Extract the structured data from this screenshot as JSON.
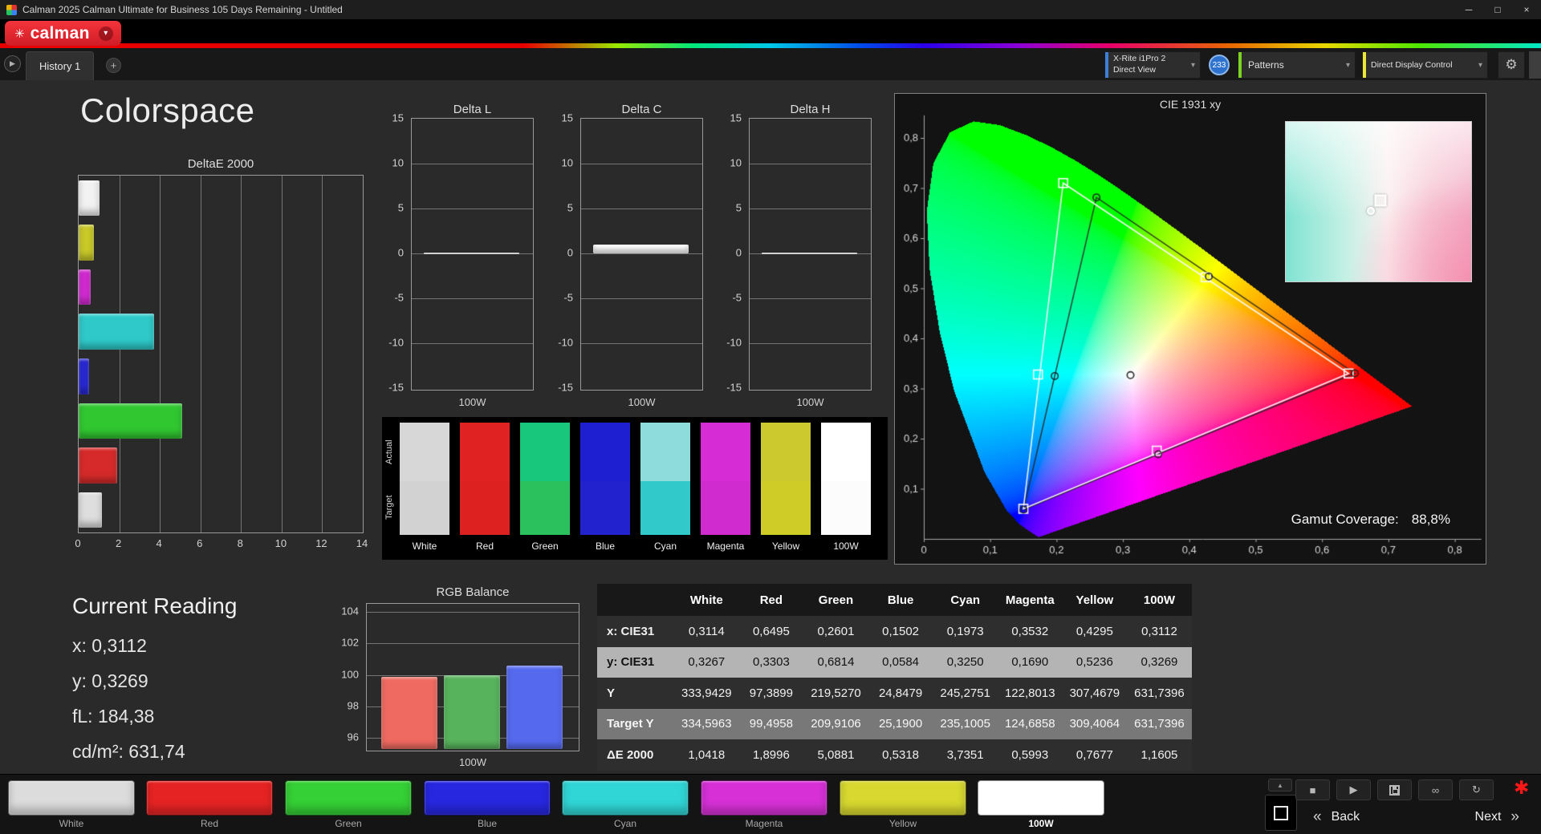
{
  "window": {
    "title": "Calman 2025 Calman Ultimate for Business 105 Days Remaining  - Untitled"
  },
  "logo": {
    "brand": "calman"
  },
  "tabs": {
    "history_tab": "History 1"
  },
  "toolbar": {
    "meter_line1": "X-Rite i1Pro 2",
    "meter_line2": "Direct View",
    "meter_badge": "233",
    "patterns_label": "Patterns",
    "display_label": "Direct Display Control"
  },
  "page": {
    "title": "Colorspace"
  },
  "current_reading": {
    "title": "Current Reading",
    "lines": [
      "x: 0,3112",
      "y: 0,3269",
      "fL: 184,38",
      "cd/m²: 631,74"
    ]
  },
  "gamut": {
    "label": "Gamut Coverage:",
    "value": "88,8%"
  },
  "chart_data": [
    {
      "id": "deltae2000",
      "type": "bar",
      "orientation": "horizontal",
      "title": "DeltaE 2000",
      "categories": [
        "White",
        "Yellow",
        "Magenta",
        "Cyan",
        "Blue",
        "Green",
        "Red",
        "100W"
      ],
      "values": [
        1.0418,
        0.7677,
        0.5993,
        3.7351,
        0.5318,
        5.0881,
        1.8996,
        1.1605
      ],
      "colors": [
        "#f2f2f2",
        "#c9c929",
        "#d32ad3",
        "#2fc9c9",
        "#2828d6",
        "#31c731",
        "#d62a2a",
        "#dedede"
      ],
      "xlim": [
        0,
        14
      ],
      "xticks": [
        0,
        2,
        4,
        6,
        8,
        10,
        12,
        14
      ],
      "xtick_labels": [
        "0",
        "2",
        "4",
        "6",
        "8",
        "10",
        "12",
        "14"
      ]
    },
    {
      "id": "delta_l",
      "type": "bar",
      "title": "Delta L",
      "categories": [
        "100W"
      ],
      "values": [
        0.05
      ],
      "bar_color": "#ffffff",
      "ylim": [
        -15,
        15
      ],
      "yticks": [
        15,
        10,
        5,
        0,
        -5,
        -10,
        -15
      ],
      "ytick_labels": [
        "15",
        "10",
        "5",
        "0",
        "-5",
        "-10",
        "-15"
      ],
      "xlabel": "100W"
    },
    {
      "id": "delta_c",
      "type": "bar",
      "title": "Delta C",
      "categories": [
        "100W"
      ],
      "values": [
        0.95
      ],
      "bar_color": "#ffffff",
      "ylim": [
        -15,
        15
      ],
      "yticks": [
        15,
        10,
        5,
        0,
        -5,
        -10,
        -15
      ],
      "ytick_labels": [
        "15",
        "10",
        "5",
        "0",
        "-5",
        "-10",
        "-15"
      ],
      "xlabel": "100W"
    },
    {
      "id": "delta_h",
      "type": "bar",
      "title": "Delta H",
      "categories": [
        "100W"
      ],
      "values": [
        0.05
      ],
      "bar_color": "#ffffff",
      "ylim": [
        -15,
        15
      ],
      "yticks": [
        15,
        10,
        5,
        0,
        -5,
        -10,
        -15
      ],
      "ytick_labels": [
        "15",
        "10",
        "5",
        "0",
        "-5",
        "-10",
        "-15"
      ],
      "xlabel": "100W"
    },
    {
      "id": "rgb_balance",
      "type": "bar",
      "title": "RGB Balance",
      "categories": [
        "Red",
        "Green",
        "Blue"
      ],
      "values": [
        99.9,
        100.0,
        100.6
      ],
      "colors": [
        "#ef6a60",
        "#57b35c",
        "#5569ee"
      ],
      "ylim": [
        95.3,
        104.5
      ],
      "yticks": [
        104,
        102,
        100,
        98,
        96
      ],
      "ytick_labels": [
        "104",
        "102",
        "100",
        "98",
        "96"
      ],
      "xlabel": "100W"
    },
    {
      "id": "cie",
      "type": "scatter",
      "title": "CIE 1931 xy",
      "xlim": [
        0,
        0.84
      ],
      "ylim": [
        0,
        0.85
      ],
      "tick_values": [
        0,
        0.1,
        0.2,
        0.3,
        0.4,
        0.5,
        0.6,
        0.7,
        0.8
      ],
      "xtick_labels": [
        "0",
        "0,1",
        "0,2",
        "0,3",
        "0,4",
        "0,5",
        "0,6",
        "0,7",
        "0,8"
      ],
      "ytick_labels": [
        "0",
        "0,1",
        "0,2",
        "0,3",
        "0,4",
        "0,5",
        "0,6",
        "0,7",
        "0,8"
      ],
      "reference_triangle": [
        [
          0.64,
          0.33
        ],
        [
          0.21,
          0.71
        ],
        [
          0.15,
          0.06
        ]
      ],
      "measured_triangle": [
        [
          0.6495,
          0.3303
        ],
        [
          0.2601,
          0.6814
        ],
        [
          0.1502,
          0.0584
        ]
      ],
      "target_points": [
        [
          0.3127,
          0.329
        ],
        [
          0.64,
          0.33
        ],
        [
          0.21,
          0.71
        ],
        [
          0.15,
          0.06
        ],
        [
          0.172,
          0.328
        ],
        [
          0.351,
          0.176
        ],
        [
          0.425,
          0.522
        ]
      ],
      "measured_points": [
        [
          0.3114,
          0.3267
        ],
        [
          0.6495,
          0.3303
        ],
        [
          0.2601,
          0.6814
        ],
        [
          0.1502,
          0.0584
        ],
        [
          0.1973,
          0.325
        ],
        [
          0.3532,
          0.169
        ],
        [
          0.4295,
          0.5236
        ]
      ],
      "locus": [
        [
          0.1741,
          0.005
        ],
        [
          0.174,
          0.005
        ],
        [
          0.1738,
          0.0049
        ],
        [
          0.1733,
          0.0048
        ],
        [
          0.1726,
          0.0048
        ],
        [
          0.1714,
          0.0051
        ],
        [
          0.1689,
          0.0069
        ],
        [
          0.1644,
          0.0109
        ],
        [
          0.1566,
          0.0177
        ],
        [
          0.144,
          0.0297
        ],
        [
          0.1241,
          0.0578
        ],
        [
          0.0913,
          0.1327
        ],
        [
          0.0454,
          0.295
        ],
        [
          0.0235,
          0.4127
        ],
        [
          0.0082,
          0.5384
        ],
        [
          0.0039,
          0.6548
        ],
        [
          0.0139,
          0.7502
        ],
        [
          0.0389,
          0.812
        ],
        [
          0.0743,
          0.8338
        ],
        [
          0.1142,
          0.8262
        ],
        [
          0.1547,
          0.8059
        ],
        [
          0.1929,
          0.7816
        ],
        [
          0.2296,
          0.7543
        ],
        [
          0.2658,
          0.7243
        ],
        [
          0.3016,
          0.6923
        ],
        [
          0.3373,
          0.6589
        ],
        [
          0.3731,
          0.6245
        ],
        [
          0.4087,
          0.5896
        ],
        [
          0.4441,
          0.5547
        ],
        [
          0.4788,
          0.5202
        ],
        [
          0.5125,
          0.4866
        ],
        [
          0.5448,
          0.4544
        ],
        [
          0.5752,
          0.4242
        ],
        [
          0.6029,
          0.3965
        ],
        [
          0.627,
          0.3725
        ],
        [
          0.6482,
          0.3514
        ],
        [
          0.6658,
          0.334
        ],
        [
          0.6801,
          0.3197
        ],
        [
          0.6915,
          0.3083
        ],
        [
          0.7006,
          0.2993
        ],
        [
          0.7079,
          0.292
        ],
        [
          0.714,
          0.2859
        ],
        [
          0.719,
          0.2809
        ],
        [
          0.723,
          0.277
        ],
        [
          0.726,
          0.274
        ],
        [
          0.7283,
          0.2717
        ],
        [
          0.73,
          0.27
        ],
        [
          0.7311,
          0.2689
        ],
        [
          0.732,
          0.268
        ],
        [
          0.7327,
          0.2673
        ],
        [
          0.7334,
          0.2666
        ],
        [
          0.734,
          0.266
        ],
        [
          0.7344,
          0.2656
        ],
        [
          0.7346,
          0.2654
        ],
        [
          0.7347,
          0.2653
        ]
      ]
    }
  ],
  "swatches": {
    "row_labels": [
      "Actual",
      "Target"
    ],
    "columns": [
      {
        "label": "White",
        "actual": "#d7d7d7",
        "target": "#d2d2d2"
      },
      {
        "label": "Red",
        "actual": "#e12222",
        "target": "#dd2121"
      },
      {
        "label": "Green",
        "actual": "#19c77c",
        "target": "#2bc25d"
      },
      {
        "label": "Blue",
        "actual": "#1f1fd2",
        "target": "#2222cf"
      },
      {
        "label": "Cyan",
        "actual": "#8edcdc",
        "target": "#31c9c9"
      },
      {
        "label": "Magenta",
        "actual": "#d52cd5",
        "target": "#cf2bcf"
      },
      {
        "label": "Yellow",
        "actual": "#cbc92d",
        "target": "#cfcc28"
      },
      {
        "label": "100W",
        "actual": "#ffffff",
        "target": "#fcfcfc"
      }
    ]
  },
  "table": {
    "columns": [
      "",
      "White",
      "Red",
      "Green",
      "Blue",
      "Cyan",
      "Magenta",
      "Yellow",
      "100W"
    ],
    "rows": [
      {
        "label": "x: CIE31",
        "style": "dark",
        "values": [
          "0,3114",
          "0,6495",
          "0,2601",
          "0,1502",
          "0,1973",
          "0,3532",
          "0,4295",
          "0,3112"
        ]
      },
      {
        "label": "y: CIE31",
        "style": "light",
        "values": [
          "0,3267",
          "0,3303",
          "0,6814",
          "0,0584",
          "0,3250",
          "0,1690",
          "0,5236",
          "0,3269"
        ]
      },
      {
        "label": "Y",
        "style": "dark",
        "values": [
          "333,9429",
          "97,3899",
          "219,5270",
          "24,8479",
          "245,2751",
          "122,8013",
          "307,4679",
          "631,7396"
        ]
      },
      {
        "label": "Target Y",
        "style": "mid",
        "values": [
          "334,5963",
          "99,4958",
          "209,9106",
          "25,1900",
          "235,1005",
          "124,6858",
          "309,4064",
          "631,7396"
        ]
      },
      {
        "label": "ΔE 2000",
        "style": "dark",
        "values": [
          "1,0418",
          "1,8996",
          "5,0881",
          "0,5318",
          "3,7351",
          "0,5993",
          "0,7677",
          "1,1605"
        ]
      }
    ]
  },
  "pattern_bar": {
    "buttons": [
      {
        "label": "White",
        "color": "#dcdcdc",
        "selected": false
      },
      {
        "label": "Red",
        "color": "#e62323",
        "selected": false
      },
      {
        "label": "Green",
        "color": "#35d035",
        "selected": false
      },
      {
        "label": "Blue",
        "color": "#2727e0",
        "selected": false
      },
      {
        "label": "Cyan",
        "color": "#30d5d5",
        "selected": false
      },
      {
        "label": "Magenta",
        "color": "#d630d6",
        "selected": false
      },
      {
        "label": "Yellow",
        "color": "#d8d830",
        "selected": false
      },
      {
        "label": "100W",
        "color": "#ffffff",
        "selected": true
      }
    ]
  },
  "nav": {
    "back": "Back",
    "next": "Next"
  },
  "icons": {
    "minimize": "─",
    "restore": "□",
    "close": "×",
    "logo_star": "✳",
    "dropdown": "▾",
    "flyout": "▶",
    "add_tab": "+",
    "gear": "⚙",
    "up": "▲",
    "stop": "■",
    "play": "▶",
    "link": "∞",
    "refresh": "↻",
    "back": "«",
    "next": "»",
    "session": "✱"
  }
}
